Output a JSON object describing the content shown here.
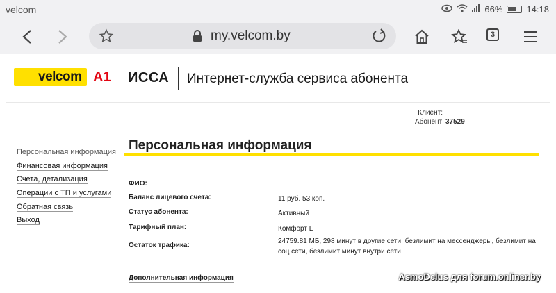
{
  "status_bar": {
    "carrier": "velcom",
    "battery": "66%",
    "time": "14:18"
  },
  "browser": {
    "url": "my.velcom.by",
    "tab_count": "3"
  },
  "header": {
    "logo": "velcom",
    "logo_a1": "A1",
    "issa": "ИССА",
    "service_title": "Интернет-служба сервиса абонента"
  },
  "client": {
    "client_label": "Клиент:",
    "client_value": "",
    "subscriber_label": "Абонент:",
    "subscriber_value": "37529"
  },
  "sidebar": {
    "items": [
      {
        "label": "Персональная информация"
      },
      {
        "label": "Финансовая информация"
      },
      {
        "label": "Счета, детализация"
      },
      {
        "label": "Операции с ТП и услугами"
      },
      {
        "label": "Обратная связь"
      },
      {
        "label": "Выход"
      }
    ]
  },
  "main": {
    "title": "Персональная информация",
    "rows": [
      {
        "label": "ФИО:",
        "value": ""
      },
      {
        "label": "Баланс лицевого счета:",
        "value": "11 руб. 53 коп."
      },
      {
        "label": "Статус абонента:",
        "value": "Активный"
      },
      {
        "label": "Тарифный план:",
        "value": "Комфорт L"
      },
      {
        "label": "Остаток трафика:",
        "value": "24759.81 МБ, 298 минут в другие сети, безлимит на мессенджеры, безлимит на соц сети, безлимит минут внутри сети"
      }
    ],
    "extra_link": "Дополнительная информация"
  },
  "watermark": "AsmoDelus для forum.onliner.by",
  "colors": {
    "accent_yellow": "#ffe000",
    "a1_red": "#e30613"
  }
}
